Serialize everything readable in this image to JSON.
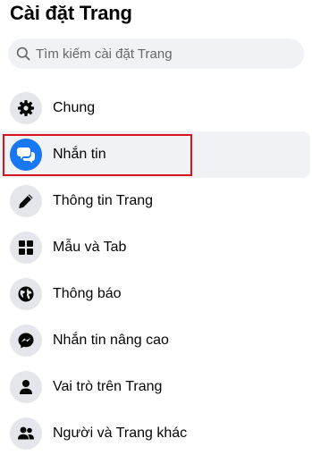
{
  "header": {
    "title": "Cài đặt Trang"
  },
  "search": {
    "placeholder": "Tìm kiếm cài đặt Trang",
    "icon": "search-icon"
  },
  "menu": {
    "items": [
      {
        "label": "Chung",
        "icon": "gear-icon",
        "active": false
      },
      {
        "label": "Nhắn tin",
        "icon": "chat-bubbles-icon",
        "active": true
      },
      {
        "label": "Thông tin Trang",
        "icon": "pencil-icon",
        "active": false
      },
      {
        "label": "Mẫu và Tab",
        "icon": "grid-icon",
        "active": false
      },
      {
        "label": "Thông báo",
        "icon": "globe-icon",
        "active": false
      },
      {
        "label": "Nhắn tin nâng cao",
        "icon": "messenger-icon",
        "active": false
      },
      {
        "label": "Vai trò trên Trang",
        "icon": "person-icon",
        "active": false
      },
      {
        "label": "Người và Trang khác",
        "icon": "people-icon",
        "active": false
      }
    ]
  },
  "colors": {
    "accent": "#1877f2",
    "highlight_box": "#d9131c",
    "icon_bg": "#e4e6eb",
    "active_bg": "#f0f2f5"
  }
}
